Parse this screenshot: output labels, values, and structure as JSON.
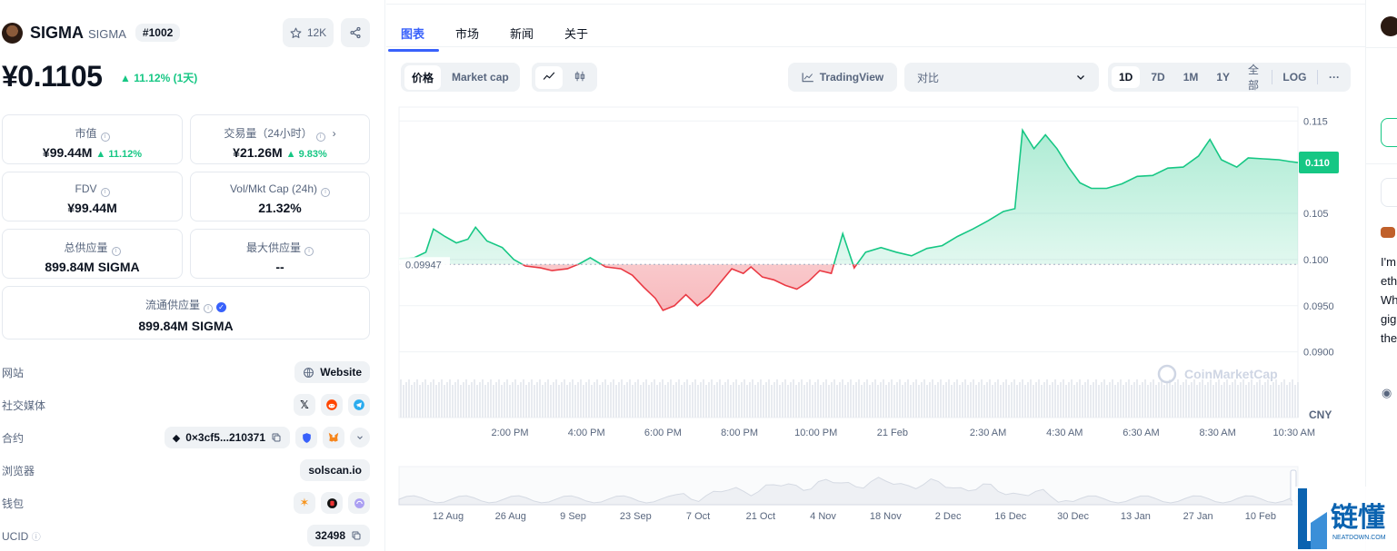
{
  "coin": {
    "name": "SIGMA",
    "symbol": "SIGMA",
    "rank": "#1002",
    "watchlist_count": "12K",
    "price": "¥0.1105",
    "price_change": "11.12% (1天)"
  },
  "stats": {
    "market_cap": {
      "label": "市值",
      "value": "¥99.44M",
      "change": "11.12%"
    },
    "volume": {
      "label": "交易量（24小时）",
      "value": "¥21.26M",
      "change": "9.83%"
    },
    "fdv": {
      "label": "FDV",
      "value": "¥99.44M"
    },
    "vol_mkt_cap": {
      "label": "Vol/Mkt Cap (24h)",
      "value": "21.32%"
    },
    "total_supply": {
      "label": "总供应量",
      "value": "899.84M SIGMA"
    },
    "max_supply": {
      "label": "最大供应量",
      "value": "--"
    },
    "circulating_supply": {
      "label": "流通供应量",
      "value": "899.84M SIGMA"
    }
  },
  "info": {
    "website": {
      "label": "网站",
      "value": "Website"
    },
    "social": {
      "label": "社交媒体"
    },
    "contract": {
      "label": "合约",
      "value": "0×3cf5...210371"
    },
    "explorer": {
      "label": "浏览器",
      "value": "solscan.io"
    },
    "wallet": {
      "label": "钱包"
    },
    "ucid": {
      "label": "UCID",
      "value": "32498"
    }
  },
  "tabs": [
    "图表",
    "市场",
    "新闻",
    "关于"
  ],
  "toolbar": {
    "price_label": "价格",
    "market_cap_label": "Market cap",
    "tradingview_label": "TradingView",
    "compare_placeholder": "对比",
    "ranges": [
      "1D",
      "7D",
      "1M",
      "1Y",
      "全部",
      "LOG"
    ],
    "more_label": "···"
  },
  "colors": {
    "accent": "#3861fb",
    "up": "#16c784",
    "down": "#ea3943"
  },
  "chart_data": {
    "type": "area",
    "currency_label": "CNY",
    "baseline_label": "0.09947",
    "current_label": "0.110",
    "baseline": 0.09947,
    "y_ticks": [
      "0.115",
      "0.105",
      "0.100",
      "0.0950",
      "0.0900"
    ],
    "y_tick_values": [
      0.115,
      0.105,
      0.1,
      0.095,
      0.09
    ],
    "y_range": [
      0.088,
      0.1165
    ],
    "x_ticks": [
      "2:00 PM",
      "4:00 PM",
      "6:00 PM",
      "8:00 PM",
      "10:00 PM",
      "21 Feb",
      "2:30 AM",
      "4:30 AM",
      "6:30 AM",
      "8:30 AM",
      "10:30 AM"
    ],
    "x_tick_hours": [
      2.9,
      4.9,
      6.9,
      8.9,
      10.9,
      12.9,
      15.4,
      17.4,
      19.4,
      21.4,
      23.4
    ],
    "series": [
      {
        "values": [
          [
            0.0,
            0.1001
          ],
          [
            0.4,
            0.1002
          ],
          [
            0.7,
            0.1008
          ],
          [
            0.9,
            0.1033
          ],
          [
            1.2,
            0.1025
          ],
          [
            1.5,
            0.1018
          ],
          [
            1.8,
            0.1022
          ],
          [
            2.0,
            0.1035
          ],
          [
            2.3,
            0.102
          ],
          [
            2.7,
            0.1013
          ],
          [
            3.0,
            0.1
          ],
          [
            3.3,
            0.0993
          ],
          [
            3.7,
            0.0991
          ],
          [
            4.0,
            0.0988
          ],
          [
            4.4,
            0.099
          ],
          [
            4.7,
            0.0995
          ],
          [
            5.0,
            0.1002
          ],
          [
            5.4,
            0.0992
          ],
          [
            5.8,
            0.099
          ],
          [
            6.1,
            0.0983
          ],
          [
            6.4,
            0.097
          ],
          [
            6.7,
            0.0958
          ],
          [
            6.9,
            0.0945
          ],
          [
            7.2,
            0.095
          ],
          [
            7.5,
            0.0962
          ],
          [
            7.8,
            0.095
          ],
          [
            8.1,
            0.096
          ],
          [
            8.4,
            0.0975
          ],
          [
            8.7,
            0.099
          ],
          [
            9.0,
            0.0985
          ],
          [
            9.2,
            0.0992
          ],
          [
            9.5,
            0.0981
          ],
          [
            9.8,
            0.0978
          ],
          [
            10.1,
            0.0972
          ],
          [
            10.4,
            0.0968
          ],
          [
            10.7,
            0.0976
          ],
          [
            11.0,
            0.0988
          ],
          [
            11.3,
            0.0985
          ],
          [
            11.6,
            0.1028
          ],
          [
            11.9,
            0.0991
          ],
          [
            12.2,
            0.1008
          ],
          [
            12.6,
            0.1013
          ],
          [
            13.0,
            0.1008
          ],
          [
            13.4,
            0.1004
          ],
          [
            13.8,
            0.1012
          ],
          [
            14.2,
            0.1015
          ],
          [
            14.6,
            0.1025
          ],
          [
            15.0,
            0.1033
          ],
          [
            15.4,
            0.1042
          ],
          [
            15.8,
            0.1052
          ],
          [
            16.1,
            0.1055
          ],
          [
            16.3,
            0.114
          ],
          [
            16.6,
            0.112
          ],
          [
            16.9,
            0.1135
          ],
          [
            17.2,
            0.112
          ],
          [
            17.5,
            0.11
          ],
          [
            17.8,
            0.1083
          ],
          [
            18.1,
            0.1077
          ],
          [
            18.5,
            0.1077
          ],
          [
            18.9,
            0.1082
          ],
          [
            19.3,
            0.109
          ],
          [
            19.7,
            0.1091
          ],
          [
            20.1,
            0.1099
          ],
          [
            20.5,
            0.11
          ],
          [
            20.9,
            0.1112
          ],
          [
            21.2,
            0.113
          ],
          [
            21.5,
            0.1108
          ],
          [
            21.9,
            0.11
          ],
          [
            22.2,
            0.111
          ],
          [
            22.6,
            0.1109
          ],
          [
            23.0,
            0.1108
          ],
          [
            23.3,
            0.1106
          ],
          [
            23.5,
            0.1105
          ]
        ]
      }
    ],
    "navigator": {
      "x_ticks": [
        "12 Aug",
        "26 Aug",
        "9 Sep",
        "23 Sep",
        "7 Oct",
        "21 Oct",
        "4 Nov",
        "18 Nov",
        "2 Dec",
        "16 Dec",
        "30 Dec",
        "13 Jan",
        "27 Jan",
        "10 Feb"
      ]
    },
    "watermark": "CoinMarketCap"
  },
  "brand": {
    "name": "链懂",
    "url": "NEATDOWN.COM"
  }
}
